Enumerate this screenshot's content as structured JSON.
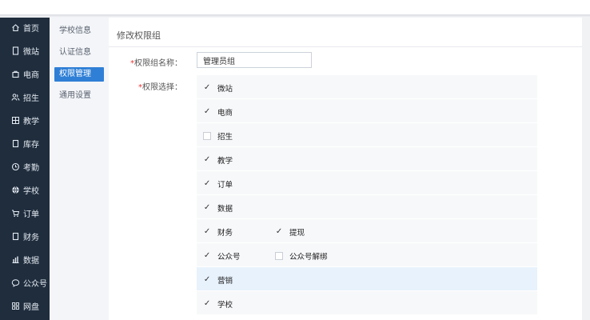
{
  "sidebar": {
    "items": [
      {
        "label": "首页",
        "icon": "home-icon"
      },
      {
        "label": "微站",
        "icon": "mobile-icon"
      },
      {
        "label": "电商",
        "icon": "bag-icon"
      },
      {
        "label": "招生",
        "icon": "people-icon"
      },
      {
        "label": "教学",
        "icon": "grid-icon"
      },
      {
        "label": "库存",
        "icon": "box-icon"
      },
      {
        "label": "考勤",
        "icon": "clock-icon"
      },
      {
        "label": "学校",
        "icon": "globe-icon"
      },
      {
        "label": "订单",
        "icon": "cart-icon"
      },
      {
        "label": "财务",
        "icon": "wallet-icon"
      },
      {
        "label": "数据",
        "icon": "bar-chart-icon"
      },
      {
        "label": "公众号",
        "icon": "chat-icon"
      },
      {
        "label": "网盘",
        "icon": "cloud-grid-icon"
      }
    ]
  },
  "subnav": {
    "items": [
      {
        "label": "学校信息",
        "active": false
      },
      {
        "label": "认证信息",
        "active": false
      },
      {
        "label": "权限管理",
        "active": true
      },
      {
        "label": "通用设置",
        "active": false
      }
    ]
  },
  "page": {
    "title": "修改权限组",
    "name_label": "权限组名称：",
    "name_value": "管理员组",
    "perm_label": "权限选择：",
    "required_mark": "*"
  },
  "permissions": [
    [
      {
        "label": "微站",
        "checked": true
      }
    ],
    [
      {
        "label": "电商",
        "checked": true
      }
    ],
    [
      {
        "label": "招生",
        "checked": false
      }
    ],
    [
      {
        "label": "教学",
        "checked": true
      }
    ],
    [
      {
        "label": "订单",
        "checked": true
      }
    ],
    [
      {
        "label": "数据",
        "checked": true
      }
    ],
    [
      {
        "label": "财务",
        "checked": true
      },
      {
        "label": "提现",
        "checked": true
      }
    ],
    [
      {
        "label": "公众号",
        "checked": true
      },
      {
        "label": "公众号解绑",
        "checked": false
      }
    ],
    [
      {
        "label": "营销",
        "checked": true
      }
    ],
    [
      {
        "label": "学校",
        "checked": true
      }
    ]
  ],
  "highlight_row": "营销",
  "colors": {
    "sidebar_bg": "#1f2d3d",
    "accent": "#2f7fd6",
    "highlight": "#e8f2fc"
  }
}
